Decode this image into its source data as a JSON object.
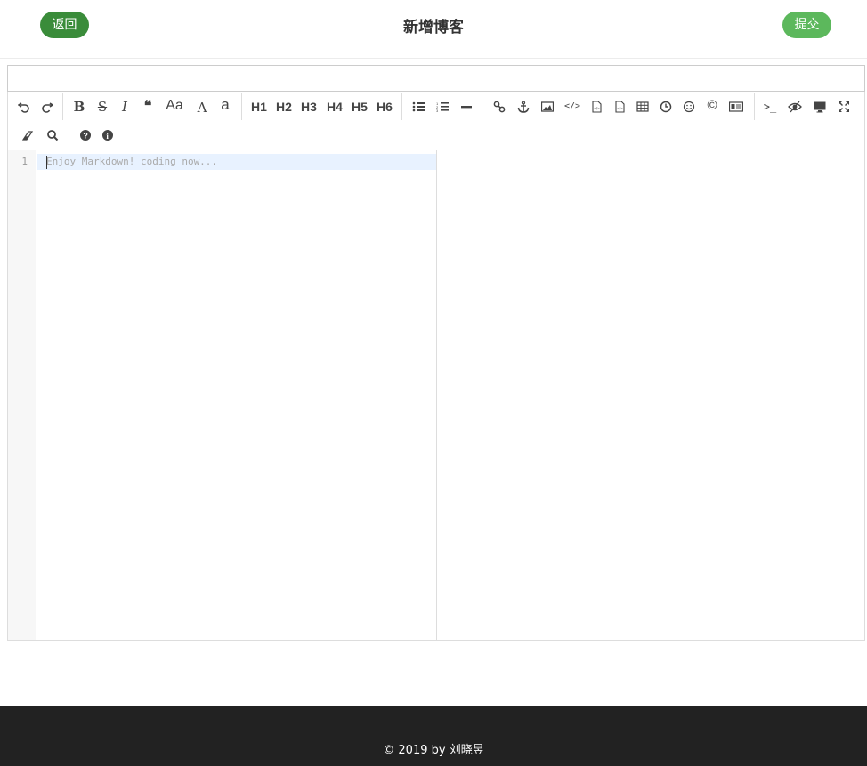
{
  "header": {
    "back_label": "返回",
    "title": "新增博客",
    "submit_label": "提交"
  },
  "title_input": {
    "value": "",
    "placeholder": ""
  },
  "toolbar": {
    "row1": [
      {
        "name": "undo-icon",
        "label": "↶"
      },
      {
        "name": "redo-icon",
        "label": "↷"
      },
      {
        "name": "bold-icon",
        "label": "B"
      },
      {
        "name": "strikethrough-icon",
        "label": "S"
      },
      {
        "name": "italic-icon",
        "label": "I"
      },
      {
        "name": "quote-icon",
        "label": "❝"
      },
      {
        "name": "uppercase-words-icon",
        "label": "Aa"
      },
      {
        "name": "uppercase-icon",
        "label": "A"
      },
      {
        "name": "lowercase-icon",
        "label": "a"
      },
      {
        "name": "h1-button",
        "label": "H1"
      },
      {
        "name": "h2-button",
        "label": "H2"
      },
      {
        "name": "h3-button",
        "label": "H3"
      },
      {
        "name": "h4-button",
        "label": "H4"
      },
      {
        "name": "h5-button",
        "label": "H5"
      },
      {
        "name": "h6-button",
        "label": "H6"
      },
      {
        "name": "unordered-list-icon",
        "label": "☰"
      },
      {
        "name": "ordered-list-icon",
        "label": "≡"
      },
      {
        "name": "horizontal-rule-icon",
        "label": "—"
      },
      {
        "name": "link-icon",
        "label": "⛓"
      },
      {
        "name": "anchor-icon",
        "label": "⚓"
      },
      {
        "name": "image-icon",
        "label": "▣"
      },
      {
        "name": "code-icon",
        "label": "</>"
      },
      {
        "name": "preformatted-text-icon",
        "label": "▤"
      },
      {
        "name": "code-block-icon",
        "label": "▥"
      },
      {
        "name": "table-icon",
        "label": "▦"
      },
      {
        "name": "datetime-icon",
        "label": "◷"
      },
      {
        "name": "emoji-icon",
        "label": "☺"
      },
      {
        "name": "html-entities-icon",
        "label": "©"
      },
      {
        "name": "pagebreak-icon",
        "label": "▭"
      },
      {
        "name": "goto-line-icon",
        "label": ">_"
      },
      {
        "name": "watch-icon",
        "label": "◉"
      },
      {
        "name": "preview-icon",
        "label": "▬"
      },
      {
        "name": "fullscreen-icon",
        "label": "⤢"
      }
    ],
    "row2": [
      {
        "name": "clear-icon",
        "label": "⌫"
      },
      {
        "name": "search-icon",
        "label": "⌕"
      },
      {
        "name": "help-icon",
        "label": "?"
      },
      {
        "name": "info-icon",
        "label": "i"
      }
    ]
  },
  "editor": {
    "line_number": "1",
    "placeholder": "Enjoy Markdown! coding now..."
  },
  "footer": {
    "text": "© 2019 by 刘晓昱"
  }
}
